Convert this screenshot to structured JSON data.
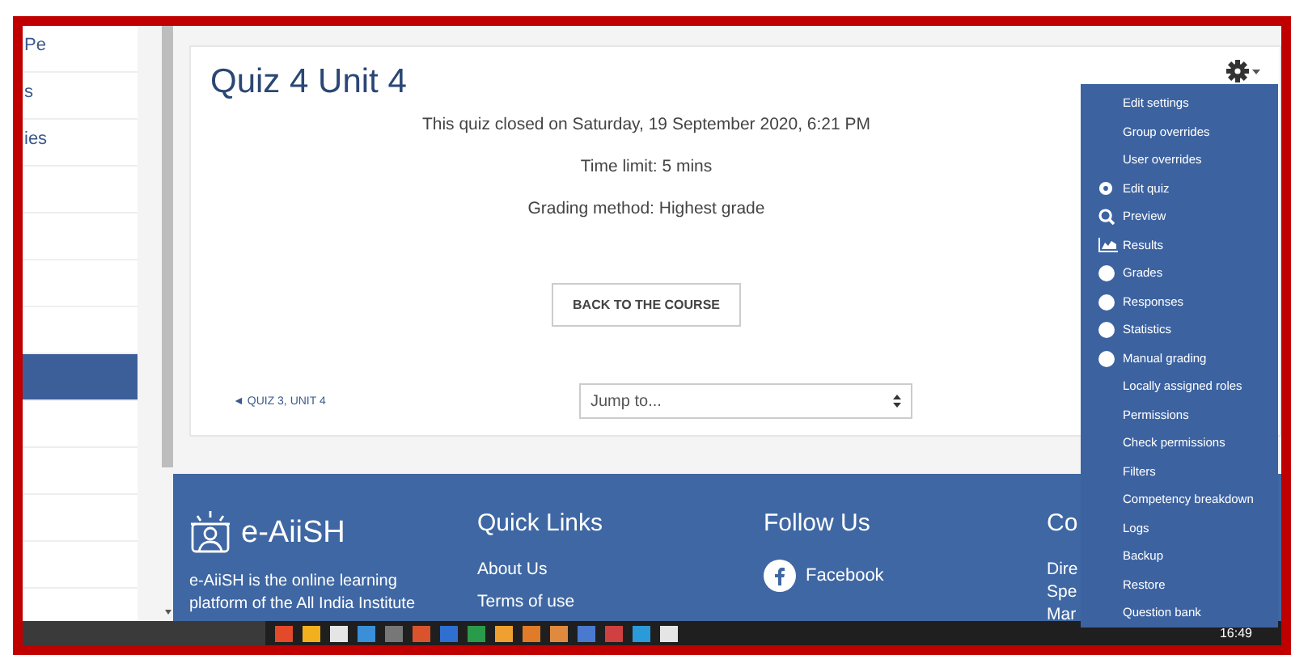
{
  "sidebar": {
    "items": [
      {
        "label": "Pe",
        "selected": false
      },
      {
        "label": "s",
        "selected": false
      },
      {
        "label": "ies",
        "selected": false
      },
      {
        "selected": false
      },
      {
        "selected": false
      },
      {
        "selected": false
      },
      {
        "selected": false
      },
      {
        "selected": true
      },
      {
        "selected": false
      },
      {
        "selected": false
      },
      {
        "selected": false
      },
      {
        "selected": false
      }
    ]
  },
  "quiz": {
    "title": "Quiz 4 Unit 4",
    "info": [
      "This quiz closed on Saturday, 19 September 2020, 6:21 PM",
      "Time limit: 5 mins",
      "Grading method: Highest grade"
    ],
    "back_button": "BACK TO THE COURSE",
    "prev_link": "◄ QUIZ 3, UNIT 4",
    "jump_select": "Jump to..."
  },
  "admin_menu": [
    {
      "label": "Edit settings",
      "kind": "none"
    },
    {
      "label": "Group overrides",
      "kind": "none"
    },
    {
      "label": "User overrides",
      "kind": "none"
    },
    {
      "label": "Edit quiz",
      "kind": "gear"
    },
    {
      "label": "Preview",
      "kind": "search"
    },
    {
      "label": "Results",
      "kind": "chart"
    },
    {
      "label": "Grades",
      "kind": "circle"
    },
    {
      "label": "Responses",
      "kind": "circle"
    },
    {
      "label": "Statistics",
      "kind": "circle"
    },
    {
      "label": "Manual grading",
      "kind": "circle"
    },
    {
      "label": "Locally assigned roles",
      "kind": "none"
    },
    {
      "label": "Permissions",
      "kind": "none"
    },
    {
      "label": "Check permissions",
      "kind": "none"
    },
    {
      "label": "Filters",
      "kind": "none"
    },
    {
      "label": "Competency breakdown",
      "kind": "none"
    },
    {
      "label": "Logs",
      "kind": "none"
    },
    {
      "label": "Backup",
      "kind": "none"
    },
    {
      "label": "Restore",
      "kind": "none"
    },
    {
      "label": "Question bank",
      "kind": "none"
    }
  ],
  "footer": {
    "brand": "e-AiiSH",
    "about": "e-AiiSH is the online learning platform of the All India Institute",
    "quick_links": {
      "title": "Quick Links",
      "links": [
        "About Us",
        "Terms of use"
      ]
    },
    "follow": {
      "title": "Follow Us",
      "links": [
        "Facebook"
      ]
    },
    "contact": {
      "title": "Co",
      "lines": [
        "Dire",
        "Spe",
        "Mar"
      ]
    }
  },
  "taskbar": {
    "time": "16:49"
  }
}
